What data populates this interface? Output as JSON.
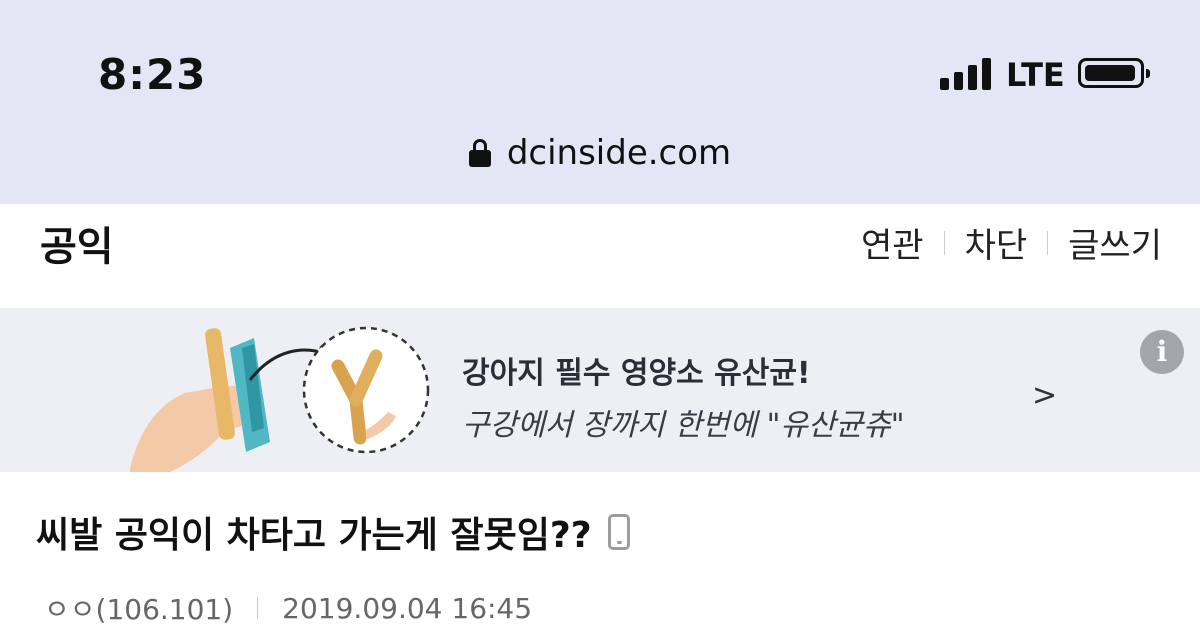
{
  "status_bar": {
    "time": "8:23",
    "network": "LTE",
    "signal_bars": 4,
    "battery_icon": "battery-full-icon"
  },
  "browser": {
    "lock_icon": "lock-icon",
    "url": "dcinside.com"
  },
  "gallery": {
    "title": "공익",
    "actions": [
      "연관",
      "차단",
      "글쓰기"
    ]
  },
  "ad": {
    "title": "강아지 필수 영양소 유산균!",
    "subtitle": "구강에서 장까지 한번에 \"유산균츄\"",
    "arrow": ">",
    "info_icon": "i"
  },
  "post": {
    "title": "씨발 공익이 차타고 가는게 잘못임??",
    "device_icon": "mobile-phone-icon",
    "author": "ㅇㅇ(106.101)",
    "date": "2019.09.04 16:45"
  },
  "colors": {
    "top_bar_bg": "#e4e6f6",
    "ad_bg": "#eeeff4",
    "text": "#111111",
    "meta_text": "#666666"
  }
}
